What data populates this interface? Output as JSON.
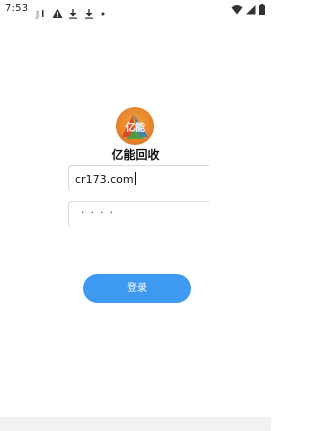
{
  "status_bar": {
    "time": "7:53",
    "left_icons": [
      "signal-badge-icon",
      "warning-icon",
      "download-icon",
      "download-icon",
      "dot-icon"
    ],
    "right_icons": [
      "wifi-icon",
      "cellular-signal-icon",
      "battery-icon"
    ]
  },
  "app": {
    "logo_text": "亿能",
    "name": "亿能回收"
  },
  "form": {
    "username_value": "cr173.com",
    "password_mask": "····"
  },
  "login_button": {
    "label": "登录"
  },
  "colors": {
    "primary": "#3d9af0",
    "logo_orange": "#e8872b"
  }
}
